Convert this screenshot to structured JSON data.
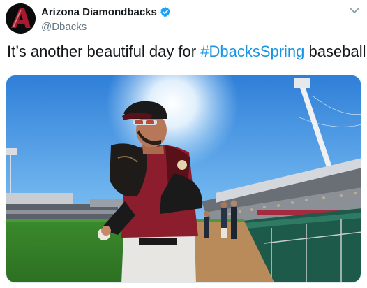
{
  "author": {
    "name": "Arizona Diamondbacks",
    "handle": "@Dbacks",
    "avatar_icon": "diamondbacks-a-logo-icon",
    "verified_icon": "verified-badge-icon"
  },
  "tweet": {
    "text_before": "It’s another beautiful day for ",
    "hashtag": "#DbacksSpring",
    "text_after": " baseball."
  },
  "menu_icon": "chevron-down-icon",
  "media": {
    "kind": "photo",
    "subject": "baseball-player-jogging-on-field"
  },
  "colors": {
    "link": "#1b95e0",
    "verified": "#1da1f2",
    "brand_red": "#a71930",
    "text": "#14171a",
    "muted": "#657786"
  }
}
